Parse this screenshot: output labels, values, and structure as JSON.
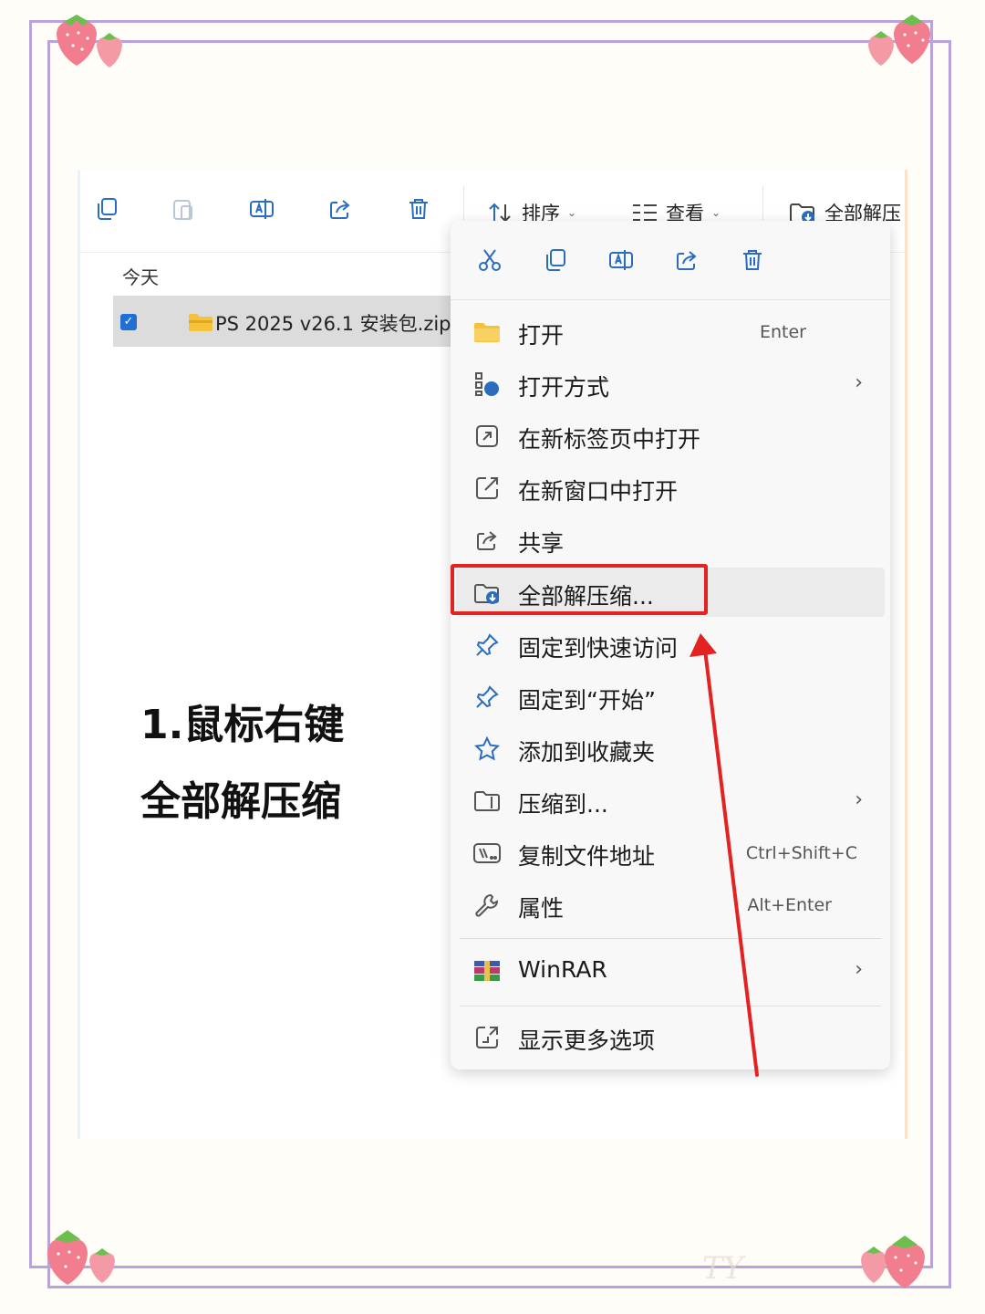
{
  "toolbar": {
    "sort_label": "排序",
    "view_label": "查看",
    "extract_label": "全部解压"
  },
  "explorer": {
    "group": "今天",
    "file_name": "PS 2025 v26.1 安装包.zip"
  },
  "caption": {
    "line1": "1.鼠标右键",
    "line2": "全部解压缩"
  },
  "quick_actions": [
    "cut-icon",
    "copy-icon",
    "rename-icon",
    "share-icon",
    "delete-icon"
  ],
  "menu": {
    "items": [
      {
        "label": "打开",
        "shortcut": "Enter",
        "icon": "folder-open-icon"
      },
      {
        "label": "打开方式",
        "submenu": "›",
        "icon": "open-with-icon"
      },
      {
        "label": "在新标签页中打开",
        "icon": "new-tab-icon"
      },
      {
        "label": "在新窗口中打开",
        "icon": "new-window-icon"
      },
      {
        "label": "共享",
        "icon": "share-icon"
      },
      {
        "label": "全部解压缩...",
        "icon": "extract-icon",
        "highlighted": true
      },
      {
        "label": "固定到快速访问",
        "icon": "pin-icon"
      },
      {
        "label": "固定到“开始”",
        "icon": "pin-icon"
      },
      {
        "label": "添加到收藏夹",
        "icon": "star-icon"
      },
      {
        "label": "压缩到...",
        "submenu": "›",
        "icon": "compress-icon"
      },
      {
        "label": "复制文件地址",
        "shortcut": "Ctrl+Shift+C",
        "icon": "copy-path-icon"
      },
      {
        "label": "属性",
        "shortcut": "Alt+Enter",
        "icon": "wrench-icon"
      }
    ],
    "winrar": {
      "label": "WinRAR",
      "submenu": "›",
      "icon": "winrar-icon"
    },
    "more": {
      "label": "显示更多选项",
      "icon": "more-options-icon"
    }
  },
  "colors": {
    "frame": "#b9a3dc",
    "highlight_box": "#e32222",
    "arrow": "#e32222",
    "checkbox": "#1f6fd6"
  },
  "watermark": "TY"
}
